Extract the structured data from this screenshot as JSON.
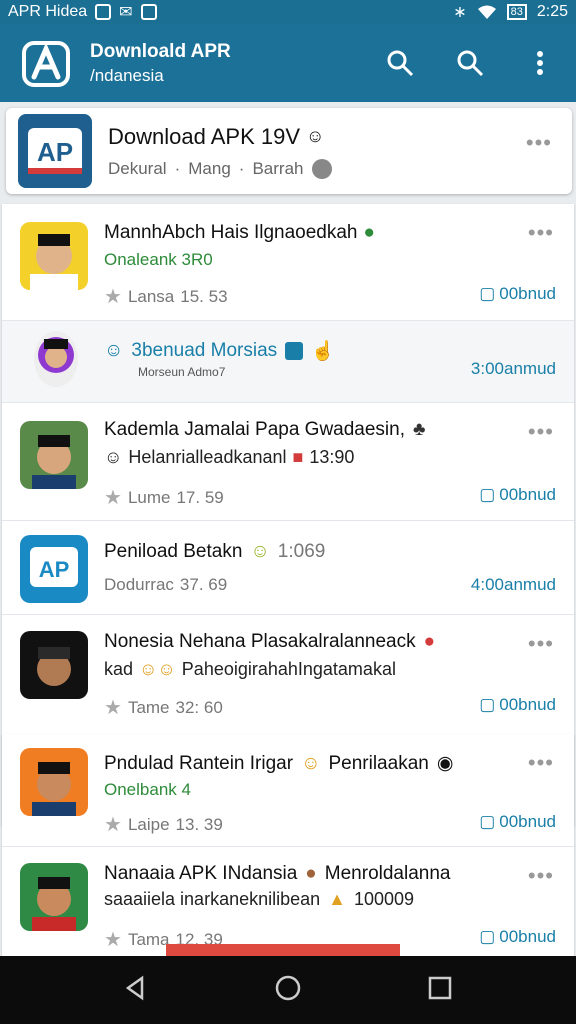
{
  "status_bar": {
    "left_text": "APR Hidea",
    "time": "2:25",
    "battery": "83"
  },
  "app_bar": {
    "title_line1": "Downloald APR",
    "title_line2": "/ndanesia"
  },
  "featured": {
    "title": "Download APK 19V",
    "sub_a": "Dekural",
    "sub_b": "Mang",
    "sub_c": "Barrah"
  },
  "cards": [
    {
      "rows": [
        {
          "title": "MannhAbch Hais Ilgnaoedkah",
          "sub": "Onaleank 3R0",
          "meta_label": "Lansa",
          "meta_value": "15. 53",
          "action": "00bnud"
        },
        {
          "title": "3benuad Morsias",
          "sub": "Morseun Admo7",
          "action": "3:00anmud"
        },
        {
          "title": "Kademla Jamalai Papa Gwadaesin,",
          "sub": "Helanrialleadkananl",
          "sub_value": "13:90",
          "meta_label": "Lume",
          "meta_value": "17. 59",
          "action": "00bnud"
        },
        {
          "title": "Peniload Betakn",
          "title_extra": "1:069",
          "meta_label": "Dodurrac",
          "meta_value": "37. 69",
          "action": "4:00anmud"
        },
        {
          "title": "Nonesia Nehana Plasakalralanneack",
          "sub": "kad",
          "sub_tail": "PaheoigirahahIngatamakal",
          "meta_label": "Tame",
          "meta_value": "32: 60",
          "action": "00bnud"
        }
      ]
    },
    {
      "rows": [
        {
          "title": "Pndulad Rantein Irigar",
          "title_tail": "Penrilaakan",
          "sub": "Onelbank 4",
          "meta_label": "Laipe",
          "meta_value": "13. 39",
          "action": "00bnud"
        },
        {
          "title": "Nanaaia APK INdansia",
          "title_tail": "Menroldalanna",
          "sub": "saaaiiela inarkaneknilibean",
          "sub_value": "100009",
          "meta_label": "Tama",
          "meta_value": "12. 39",
          "action": "00bnud"
        }
      ]
    }
  ],
  "colors": {
    "primary": "#1c7198",
    "accent_link": "#1a7fa8",
    "green": "#2e8b3a",
    "red_bar": "#de4a40"
  }
}
